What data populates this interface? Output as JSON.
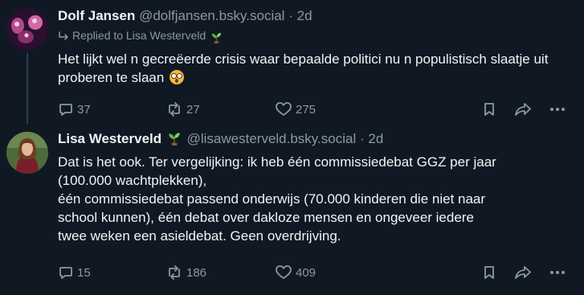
{
  "posts": [
    {
      "author_name": "Dolf Jansen",
      "handle": "@dolfjansen.bsky.social",
      "separator": "·",
      "time": "2d",
      "reply_to_label": "Replied to Lisa Westerveld",
      "text": "Het lijkt wel n gecreëerde crisis waar bepaalde politici nu n populistisch slaatje uit proberen te slaan",
      "reply_count": "37",
      "repost_count": "27",
      "like_count": "275",
      "emoji": "flushed-face"
    },
    {
      "author_name": "Lisa Westerveld",
      "author_badge": "seedling",
      "handle": "@lisawesterveld.bsky.social",
      "separator": "·",
      "time": "2d",
      "text_lines": [
        "Dat is het ook. Ter vergelijking: ik heb één commissiedebat GGZ per jaar",
        "(100.000 wachtplekken),",
        "één commissiedebat passend onderwijs (70.000 kinderen die niet naar",
        "school kunnen), één debat over dakloze mensen en ongeveer iedere",
        "twee weken een asieldebat. Geen overdrijving."
      ],
      "reply_count": "15",
      "repost_count": "186",
      "like_count": "409"
    }
  ],
  "colors": {
    "background": "#101923",
    "text": "#f1f3f5",
    "muted": "#8b98a5",
    "thread_line": "#2e3f51"
  },
  "icons": [
    "reply-icon",
    "repost-icon",
    "like-icon",
    "bookmark-icon",
    "share-icon",
    "more-icon",
    "seedling-icon",
    "reply-arrow-icon"
  ]
}
